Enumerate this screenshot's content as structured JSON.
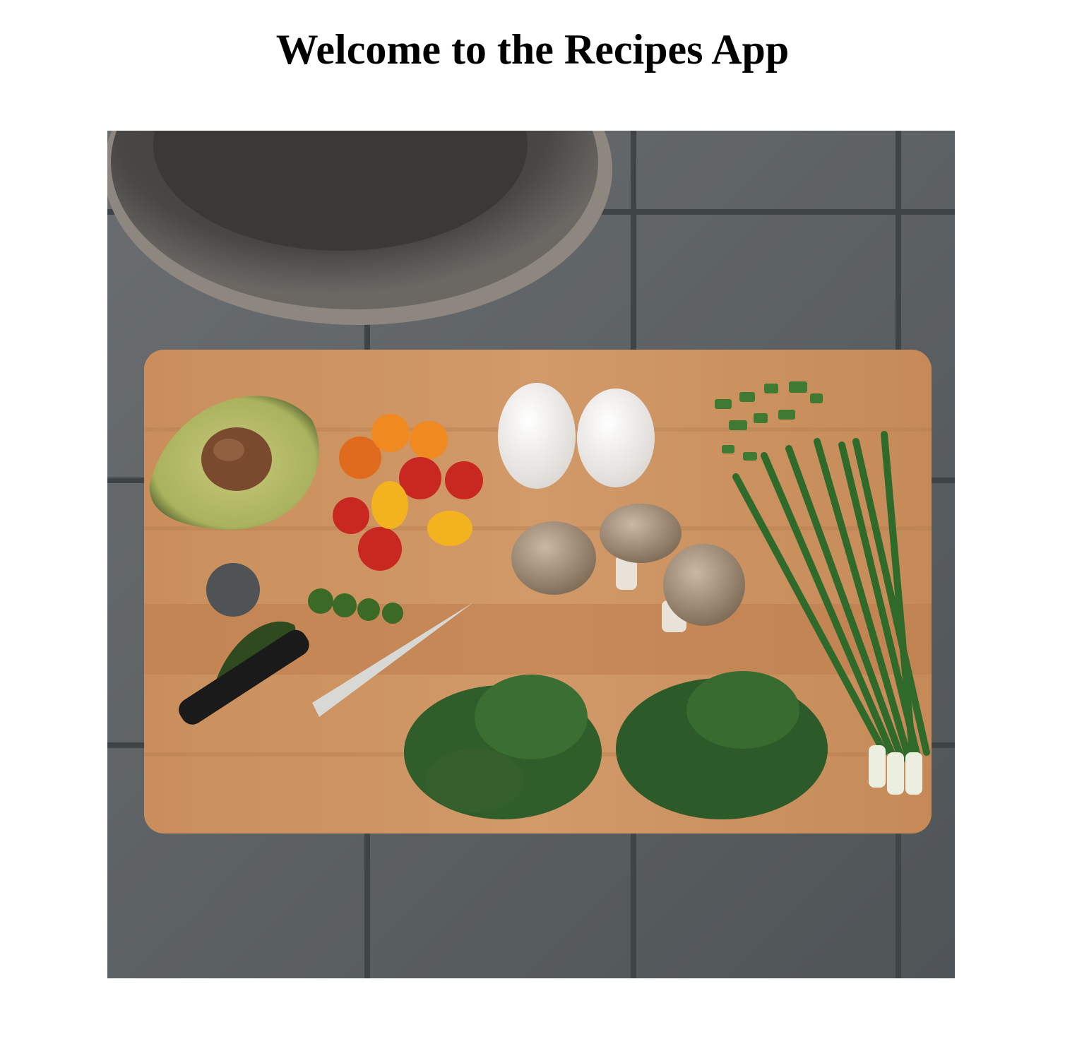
{
  "page": {
    "title": "Welcome to the Recipes App"
  },
  "hero_image": {
    "subject": "cutting-board-with-ingredients",
    "colors": {
      "tile": "#5d6266",
      "board": "#c98f5e",
      "pan": "#4a4846",
      "avocado": "#a9b25e",
      "tomato": "#c8281f",
      "egg": "#f1efec",
      "greens": "#2f5e2a"
    }
  }
}
